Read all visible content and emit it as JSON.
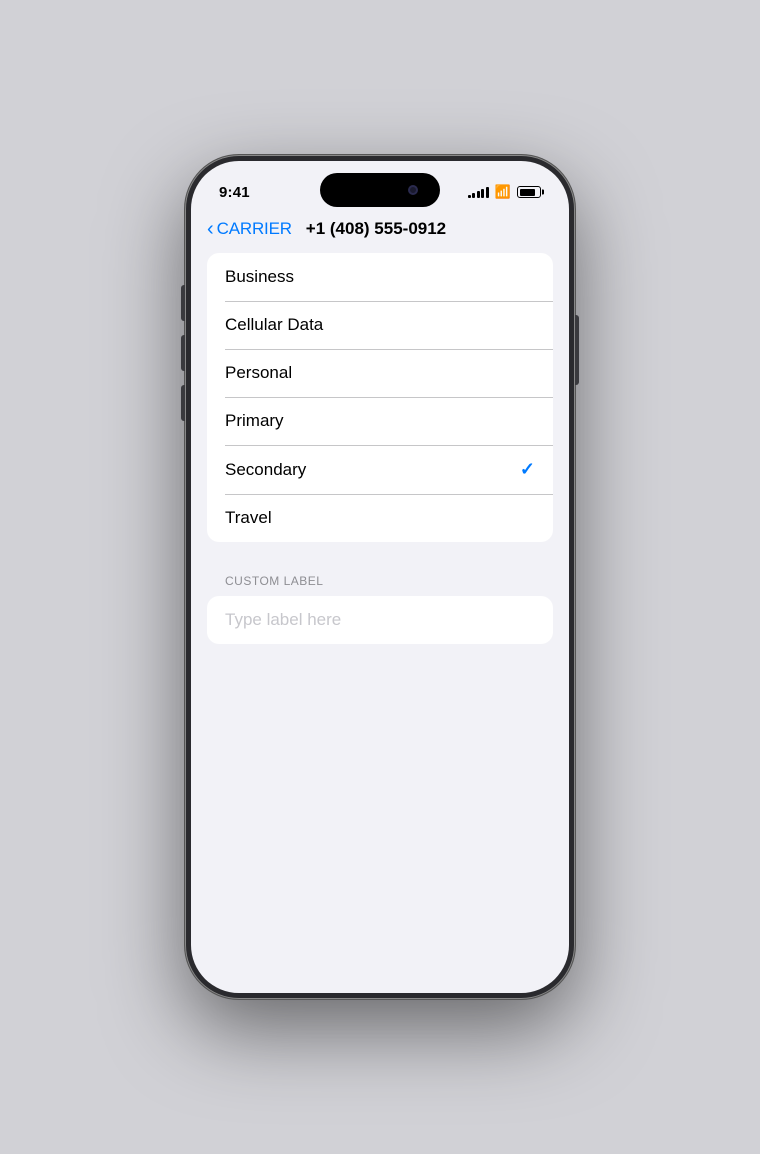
{
  "status_bar": {
    "time": "9:41",
    "signal_bars": [
      3,
      5,
      7,
      9,
      11
    ],
    "wifi": "wifi",
    "battery_pct": 80
  },
  "nav": {
    "back_label": "CARRIER",
    "title": "+1 (408) 555-0912"
  },
  "labels": [
    {
      "id": "business",
      "text": "Business",
      "selected": false
    },
    {
      "id": "cellular-data",
      "text": "Cellular Data",
      "selected": false
    },
    {
      "id": "personal",
      "text": "Personal",
      "selected": false
    },
    {
      "id": "primary",
      "text": "Primary",
      "selected": false
    },
    {
      "id": "secondary",
      "text": "Secondary",
      "selected": true
    },
    {
      "id": "travel",
      "text": "Travel",
      "selected": false
    }
  ],
  "custom_label_section": {
    "heading": "CUSTOM LABEL",
    "placeholder": "Type label here"
  },
  "colors": {
    "accent": "#007aff",
    "checkmark": "#007aff",
    "separator": "#c6c6c8",
    "bg": "#f2f2f7",
    "card_bg": "#ffffff",
    "text_primary": "#000000",
    "text_secondary": "#8e8e93",
    "input_placeholder": "#c7c7cc"
  }
}
